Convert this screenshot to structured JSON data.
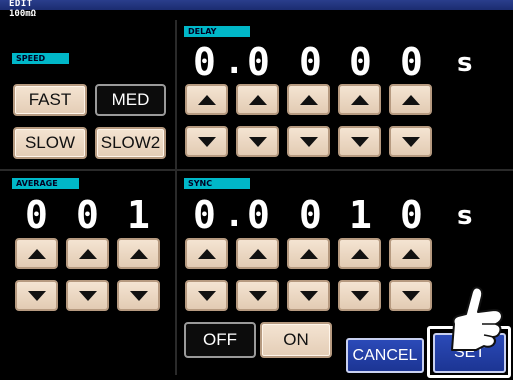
{
  "header": {
    "title": "EDIT",
    "range": "100mΩ"
  },
  "speed": {
    "label": "SPEED",
    "buttons": [
      {
        "label": "FAST",
        "selected": false
      },
      {
        "label": "MED",
        "selected": true
      },
      {
        "label": "SLOW",
        "selected": false
      },
      {
        "label": "SLOW2",
        "selected": false
      }
    ]
  },
  "delay": {
    "label": "DELAY",
    "digits": [
      "0",
      "0",
      "0",
      "0",
      "0"
    ],
    "decimal": ".",
    "unit": "s"
  },
  "average": {
    "label": "AVERAGE",
    "digits": [
      "0",
      "0",
      "1"
    ]
  },
  "sync": {
    "label": "SYNC",
    "digits": [
      "0",
      "0",
      "0",
      "1",
      "0"
    ],
    "decimal": ".",
    "unit": "s",
    "off_label": "OFF",
    "on_label": "ON",
    "state": "OFF"
  },
  "footer": {
    "cancel_label": "CANCEL",
    "set_label": "SET"
  },
  "colors": {
    "background": "#000000",
    "accent_label": "#00b7c8",
    "button_blue": "#1c3594",
    "key_light": "#f0dcc7",
    "titlebar": "#1b2c70"
  },
  "icons": [
    "up-arrow-icon",
    "down-arrow-icon",
    "pointing-hand-icon"
  ]
}
